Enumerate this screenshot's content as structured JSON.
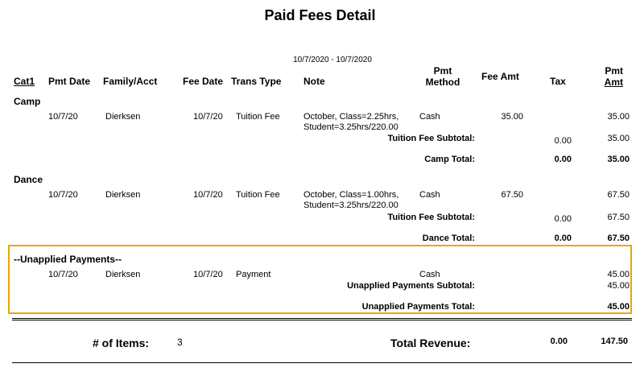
{
  "report": {
    "title": "Paid Fees Detail",
    "date_range": "10/7/2020 - 10/7/2020",
    "highlight_color": "#e8a800"
  },
  "columns": {
    "cat1": "Cat1",
    "pmt_date": "Pmt Date",
    "family_acct": "Family/Acct",
    "fee_date": "Fee Date",
    "trans_type": "Trans Type",
    "note": "Note",
    "pmt_method_1": "Pmt",
    "pmt_method_2": "Method",
    "fee_amt": "Fee Amt",
    "tax": "Tax",
    "pmt_amt_1": "Pmt",
    "pmt_amt_2": "Amt"
  },
  "groups": {
    "camp": {
      "name": "Camp",
      "row": {
        "pmt_date": "10/7/20",
        "family": "Dierksen",
        "fee_date": "10/7/20",
        "trans_type": "Tuition Fee",
        "note_1": "October, Class=2.25hrs,",
        "note_2": "Student=3.25hrs/220.00",
        "method": "Cash",
        "fee_amt": "35.00",
        "pmt_amt": "35.00"
      },
      "subtotal_label": "Tuition Fee Subtotal:",
      "subtotal_tax": "0.00",
      "subtotal_amt": "35.00",
      "total_label": "Camp Total:",
      "total_tax": "0.00",
      "total_amt": "35.00"
    },
    "dance": {
      "name": "Dance",
      "row": {
        "pmt_date": "10/7/20",
        "family": "Dierksen",
        "fee_date": "10/7/20",
        "trans_type": "Tuition Fee",
        "note_1": "October, Class=1.00hrs,",
        "note_2": "Student=3.25hrs/220.00",
        "method": "Cash",
        "fee_amt": "67.50",
        "pmt_amt": "67.50"
      },
      "subtotal_label": "Tuition Fee Subtotal:",
      "subtotal_tax": "0.00",
      "subtotal_amt": "67.50",
      "total_label": "Dance Total:",
      "total_tax": "0.00",
      "total_amt": "67.50"
    },
    "unapplied": {
      "name": "--Unapplied Payments--",
      "row": {
        "pmt_date": "10/7/20",
        "family": "Dierksen",
        "fee_date": "10/7/20",
        "trans_type": "Payment",
        "method": "Cash",
        "pmt_amt": "45.00"
      },
      "subtotal_label": "Unapplied Payments Subtotal:",
      "subtotal_amt": "45.00",
      "total_label": "Unapplied Payments Total:",
      "total_amt": "45.00"
    }
  },
  "footer": {
    "items_label": "# of Items:",
    "items_count": "3",
    "revenue_label": "Total Revenue:",
    "revenue_tax": "0.00",
    "revenue_amt": "147.50"
  }
}
